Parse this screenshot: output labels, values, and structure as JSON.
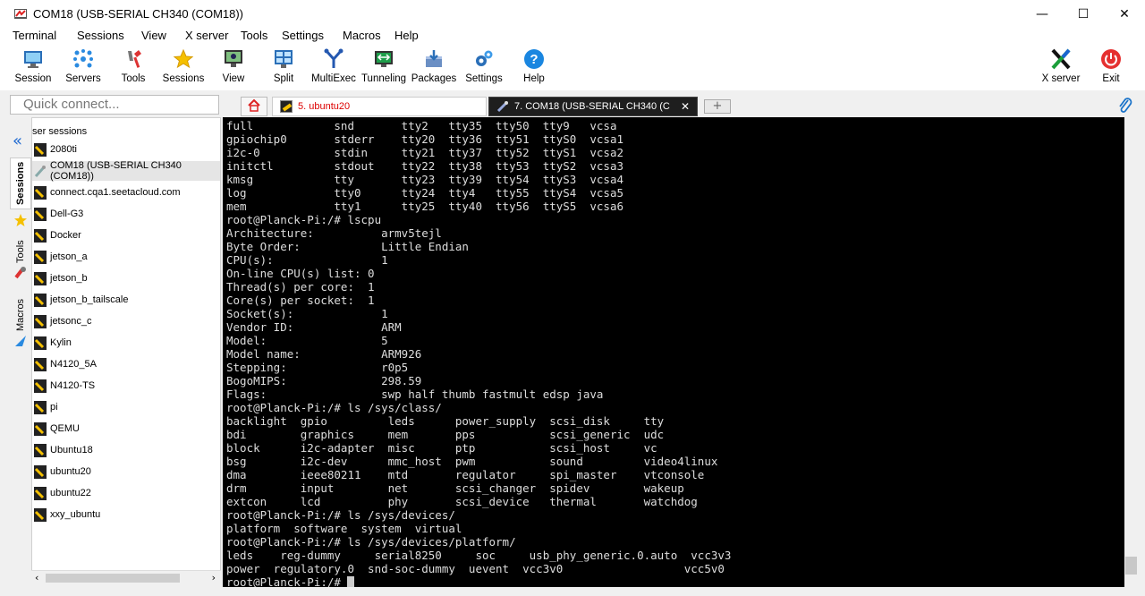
{
  "window": {
    "title": "COM18  (USB-SERIAL CH340 (COM18))",
    "min": "—",
    "max": "☐",
    "close": "✕"
  },
  "menu": [
    "Terminal",
    "Sessions",
    "View",
    "X server",
    "Tools",
    "Settings",
    "Macros",
    "Help"
  ],
  "toolbar": {
    "session": "Session",
    "servers": "Servers",
    "tools": "Tools",
    "sessions": "Sessions",
    "view": "View",
    "split": "Split",
    "multiexec": "MultiExec",
    "tunneling": "Tunneling",
    "packages": "Packages",
    "settings": "Settings",
    "help": "Help",
    "xserver": "X server",
    "exit": "Exit"
  },
  "quick_connect": {
    "placeholder": "Quick connect..."
  },
  "tabs": {
    "tab1": "5. ubuntu20",
    "tab2": "7. COM18  (USB-SERIAL CH340 (C",
    "close": "✕",
    "add": "+"
  },
  "sidebar": {
    "vtabs": [
      "Sessions",
      "Tools",
      "Macros"
    ],
    "header": "ser sessions",
    "items": [
      "2080ti",
      "COM18  (USB-SERIAL CH340 (COM18))",
      "connect.cqa1.seetacloud.com",
      "Dell-G3",
      "Docker",
      "jetson_a",
      "jetson_b",
      "jetson_b_tailscale",
      "jetsonc_c",
      "Kylin",
      "N4120_5A",
      "N4120-TS",
      "pi",
      "QEMU",
      "Ubuntu18",
      "ubuntu20",
      "ubuntu22",
      "xxy_ubuntu"
    ]
  },
  "terminal": {
    "lines": [
      "full            snd       tty2   tty35  tty50  tty9   vcsa",
      "gpiochip0       stderr    tty20  tty36  tty51  ttyS0  vcsa1",
      "i2c-0           stdin     tty21  tty37  tty52  ttyS1  vcsa2",
      "initctl         stdout    tty22  tty38  tty53  ttyS2  vcsa3",
      "kmsg            tty       tty23  tty39  tty54  ttyS3  vcsa4",
      "log             tty0      tty24  tty4   tty55  ttyS4  vcsa5",
      "mem             tty1      tty25  tty40  tty56  ttyS5  vcsa6",
      "root@Planck-Pi:/# lscpu",
      "Architecture:          armv5tejl",
      "Byte Order:            Little Endian",
      "CPU(s):                1",
      "On-line CPU(s) list: 0",
      "Thread(s) per core:  1",
      "Core(s) per socket:  1",
      "Socket(s):             1",
      "Vendor ID:             ARM",
      "Model:                 5",
      "Model name:            ARM926",
      "Stepping:              r0p5",
      "BogoMIPS:              298.59",
      "Flags:                 swp half thumb fastmult edsp java",
      "root@Planck-Pi:/# ls /sys/class/",
      "backlight  gpio         leds      power_supply  scsi_disk     tty",
      "bdi        graphics     mem       pps           scsi_generic  udc",
      "block      i2c-adapter  misc      ptp           scsi_host     vc",
      "bsg        i2c-dev      mmc_host  pwm           sound         video4linux",
      "dma        ieee80211    mtd       regulator     spi_master    vtconsole",
      "drm        input        net       scsi_changer  spidev        wakeup",
      "extcon     lcd          phy       scsi_device   thermal       watchdog",
      "root@Planck-Pi:/# ls /sys/devices/",
      "platform  software  system  virtual",
      "root@Planck-Pi:/# ls /sys/devices/platform/",
      "leds    reg-dummy     serial8250     soc     usb_phy_generic.0.auto  vcc3v3",
      "power  regulatory.0  snd-soc-dummy  uevent  vcc3v0                  vcc5v0"
    ],
    "prompt": "root@Planck-Pi:/# "
  }
}
